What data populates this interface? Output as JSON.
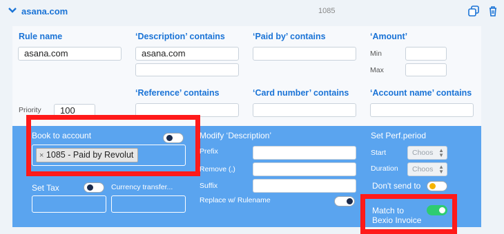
{
  "header": {
    "title": "asana.com",
    "number": "1085",
    "icons": [
      "chevron-down-icon",
      "copy-icon",
      "trash-icon"
    ]
  },
  "filters": {
    "rule_name_label": "Rule name",
    "rule_name_value": "asana.com",
    "description_label": "‘Description’ contains",
    "description_value": "asana.com",
    "paid_by_label": "‘Paid by’ contains",
    "amount_label": "‘Amount’",
    "min_label": "Min",
    "max_label": "Max",
    "reference_label": "‘Reference’ contains",
    "card_number_label": "‘Card number’ contains",
    "account_name_label": "‘Account name’ contains",
    "priority_label": "Priority",
    "priority_value": "100"
  },
  "actions": {
    "book_to_account_label": "Book to account",
    "book_tag": "1085 - Paid by Revolut",
    "book_tag_remove": "×",
    "set_tax_label": "Set Tax",
    "currency_transfer_label": "Currency transfer...",
    "modify_description_label": "Modify ‘Description’",
    "prefix_label": "Prefix",
    "remove_label": "Remove (,)",
    "suffix_label": "Suffix",
    "replace_label": "Replace w/ Rulename",
    "set_period_label": "Set Perf.period",
    "start_label": "Start",
    "duration_label": "Duration",
    "choose_placeholder": "Choos",
    "dont_send_label": "Don't send to",
    "match_bexio_label_1": "Match to",
    "match_bexio_label_2": "Bexio Invoice"
  },
  "colors": {
    "accent": "#1a73d6",
    "action_panel": "#5aa4ef",
    "highlight": "#ff1a1a",
    "toggle_on": "#2ecc71",
    "toggle_dot_warn": "#f5b400"
  }
}
